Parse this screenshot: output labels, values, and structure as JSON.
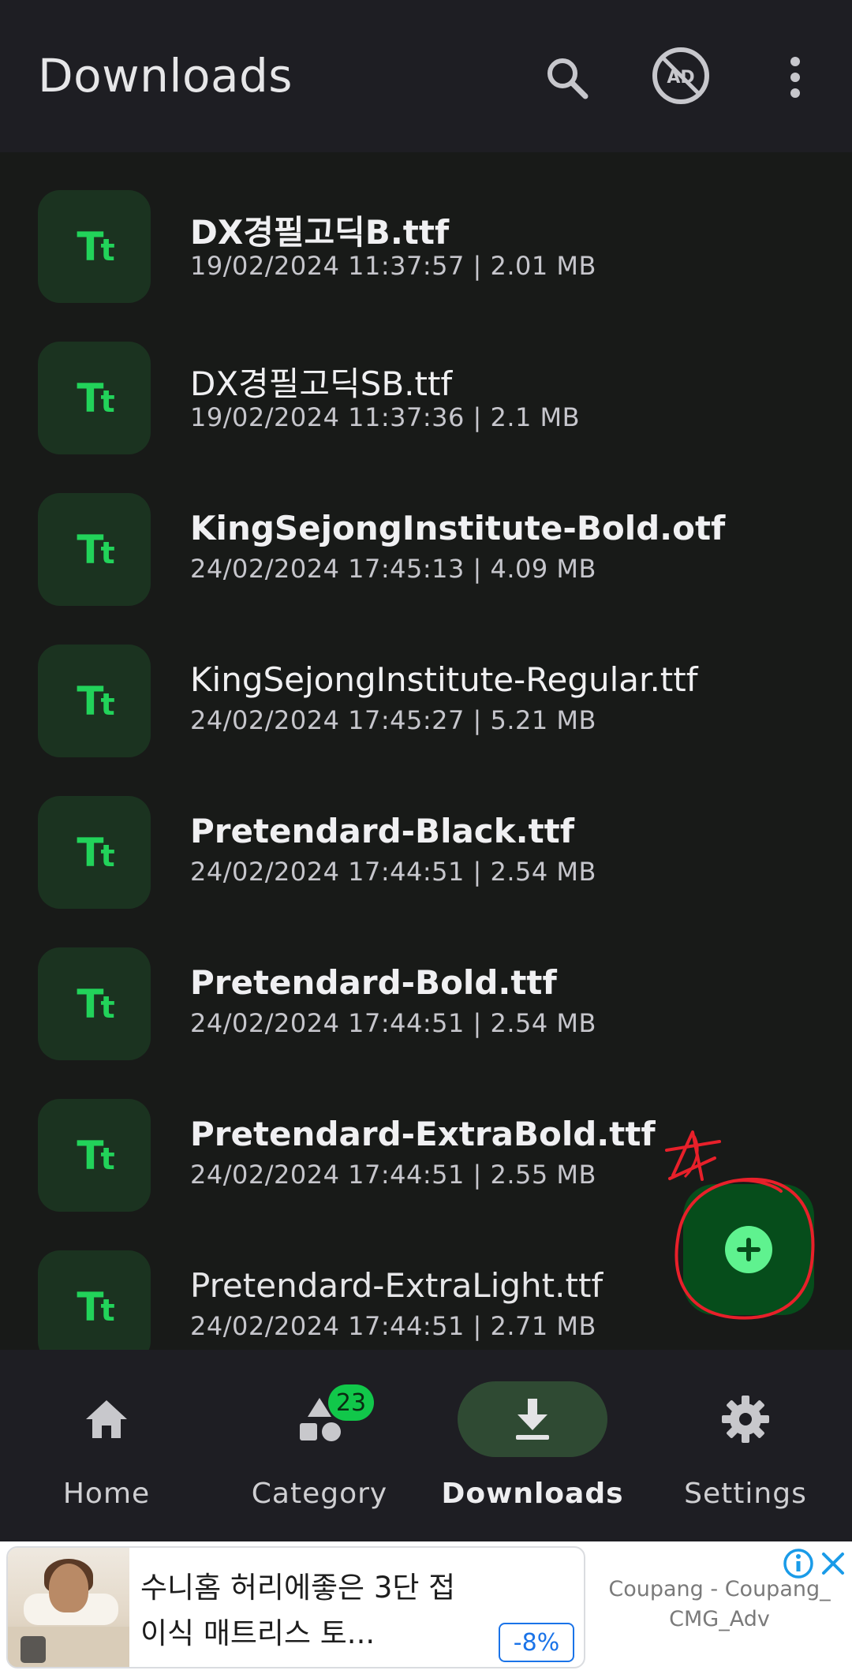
{
  "appbar": {
    "title": "Downloads",
    "icons": [
      "search-icon",
      "ad-free-icon",
      "more-vert-icon"
    ],
    "ad_icon_text": "AD"
  },
  "files": [
    {
      "name": "DX경필고딕B.ttf",
      "meta": "19/02/2024 11:37:57 | 2.01 MB",
      "weight": "medium",
      "icon": "font-file-icon"
    },
    {
      "name": "DX경필고딕SB.ttf",
      "meta": "19/02/2024 11:37:36 | 2.1 MB",
      "weight": "regular",
      "icon": "font-file-icon"
    },
    {
      "name": "KingSejongInstitute-Bold.otf",
      "meta": "24/02/2024 17:45:13 | 4.09 MB",
      "weight": "bold",
      "icon": "font-file-icon"
    },
    {
      "name": "KingSejongInstitute-Regular.ttf",
      "meta": "24/02/2024 17:45:27 | 5.21 MB",
      "weight": "regular",
      "icon": "font-file-icon"
    },
    {
      "name": "Pretendard-Black.ttf",
      "meta": "24/02/2024 17:44:51 | 2.54 MB",
      "weight": "bold",
      "icon": "font-file-icon"
    },
    {
      "name": "Pretendard-Bold.ttf",
      "meta": "24/02/2024 17:44:51 | 2.54 MB",
      "weight": "bold",
      "icon": "font-file-icon"
    },
    {
      "name": "Pretendard-ExtraBold.ttf",
      "meta": "24/02/2024 17:44:51 | 2.55 MB",
      "weight": "bold",
      "icon": "font-file-icon"
    },
    {
      "name": "Pretendard-ExtraLight.ttf",
      "meta": "24/02/2024 17:44:51 | 2.71 MB",
      "weight": "light",
      "icon": "font-file-icon"
    }
  ],
  "tile_glyph": "Tt",
  "fab": {
    "icon": "add-icon"
  },
  "bottom_nav": {
    "items": [
      {
        "label": "Home",
        "icon": "home-icon",
        "active": false
      },
      {
        "label": "Category",
        "icon": "category-icon",
        "active": false,
        "badge": "23"
      },
      {
        "label": "Downloads",
        "icon": "download-icon",
        "active": true
      },
      {
        "label": "Settings",
        "icon": "settings-icon",
        "active": false
      }
    ]
  },
  "ad": {
    "title": "수니홈 허리에좋은 3단 접이식 매트리스 토...",
    "discount": "-8%",
    "source": "Coupang - Coupang_ CMG_Adv",
    "icons": [
      "info-icon",
      "close-icon"
    ]
  },
  "colors": {
    "background": "#181a18",
    "appbar": "#1e1e23",
    "accent_green": "#22d35a",
    "tile_bg": "#1b3320",
    "fab_bg": "#064d1b",
    "badge_bg": "#11c74a",
    "annotation_red": "#e8202a"
  }
}
